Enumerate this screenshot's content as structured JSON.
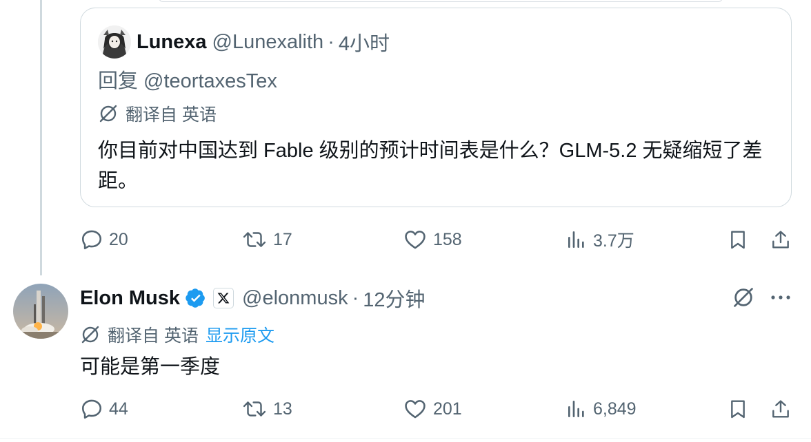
{
  "quote": {
    "name": "Lunexa",
    "handle": "@Lunexalith",
    "separator": "·",
    "time": "4小时",
    "reply_to": "回复 @teortaxesTex",
    "translate_label": "翻译自 英语",
    "body": "你目前对中国达到 Fable 级别的预计时间表是什么？GLM-5.2 无疑缩短了差距。"
  },
  "quote_actions": {
    "replies": "20",
    "reposts": "17",
    "likes": "158",
    "views": "3.7万"
  },
  "reply": {
    "name": "Elon Musk",
    "handle": "@elonmusk",
    "separator": "·",
    "time": "12分钟",
    "translate_label": "翻译自 英语",
    "show_original": "显示原文",
    "body": "可能是第一季度"
  },
  "reply_actions": {
    "replies": "44",
    "reposts": "13",
    "likes": "201",
    "views": "6,849"
  },
  "icons": {
    "reply": "reply-icon",
    "repost": "repost-icon",
    "like": "heart-icon",
    "views": "views-icon",
    "bookmark": "bookmark-icon",
    "share": "share-icon",
    "translate": "translate-icon",
    "verified": "verified-badge-icon",
    "more": "more-icon"
  },
  "colors": {
    "text": "#0f1419",
    "secondary": "#536471",
    "accent": "#1d9bf0",
    "border": "#cfd9de"
  }
}
